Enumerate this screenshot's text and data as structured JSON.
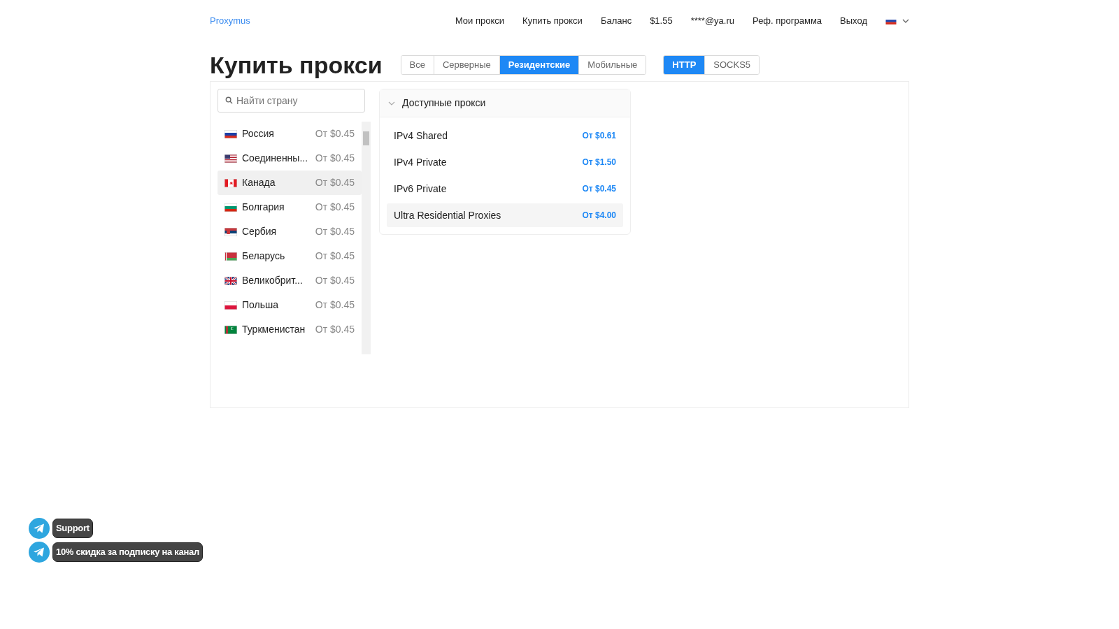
{
  "nav": {
    "brand": "Proxymus",
    "links": [
      "Мои прокси",
      "Купить прокси",
      "Баланс",
      "$1.55",
      "****@ya.ru",
      "Реф. программа",
      "Выход"
    ]
  },
  "title": "Купить прокси",
  "type_tabs": [
    {
      "label": "Все",
      "selected": false
    },
    {
      "label": "Серверные",
      "selected": false
    },
    {
      "label": "Резидентские",
      "selected": true
    },
    {
      "label": "Мобильные",
      "selected": false
    }
  ],
  "protocol_tabs": [
    {
      "label": "HTTP",
      "selected": true
    },
    {
      "label": "SOCKS5",
      "selected": false
    }
  ],
  "search": {
    "placeholder": "Найти страну"
  },
  "countries": [
    {
      "name": "Россия",
      "price": "От $0.45",
      "selected": false
    },
    {
      "name": "Соединенны...",
      "price": "От $0.45",
      "selected": false
    },
    {
      "name": "Канада",
      "price": "От $0.45",
      "selected": true
    },
    {
      "name": "Болгария",
      "price": "От $0.45",
      "selected": false
    },
    {
      "name": "Сербия",
      "price": "От $0.45",
      "selected": false
    },
    {
      "name": "Беларусь",
      "price": "От $0.45",
      "selected": false
    },
    {
      "name": "Великобрит...",
      "price": "От $0.45",
      "selected": false
    },
    {
      "name": "Польша",
      "price": "От $0.45",
      "selected": false
    },
    {
      "name": "Туркменистан",
      "price": "От $0.45",
      "selected": false
    }
  ],
  "proxies": {
    "title": "Доступные прокси",
    "expanded": true,
    "items": [
      {
        "name": "IPv4 Shared",
        "price": "От $0.61",
        "selected": false
      },
      {
        "name": "IPv4 Private",
        "price": "От $1.50",
        "selected": false
      },
      {
        "name": "IPv6 Private",
        "price": "От $0.45",
        "selected": false
      },
      {
        "name": "Ultra Residential Proxies",
        "price": "От $4.00",
        "selected": true
      }
    ]
  },
  "floating": [
    "Support",
    "10% скидка за подписку на канал"
  ]
}
